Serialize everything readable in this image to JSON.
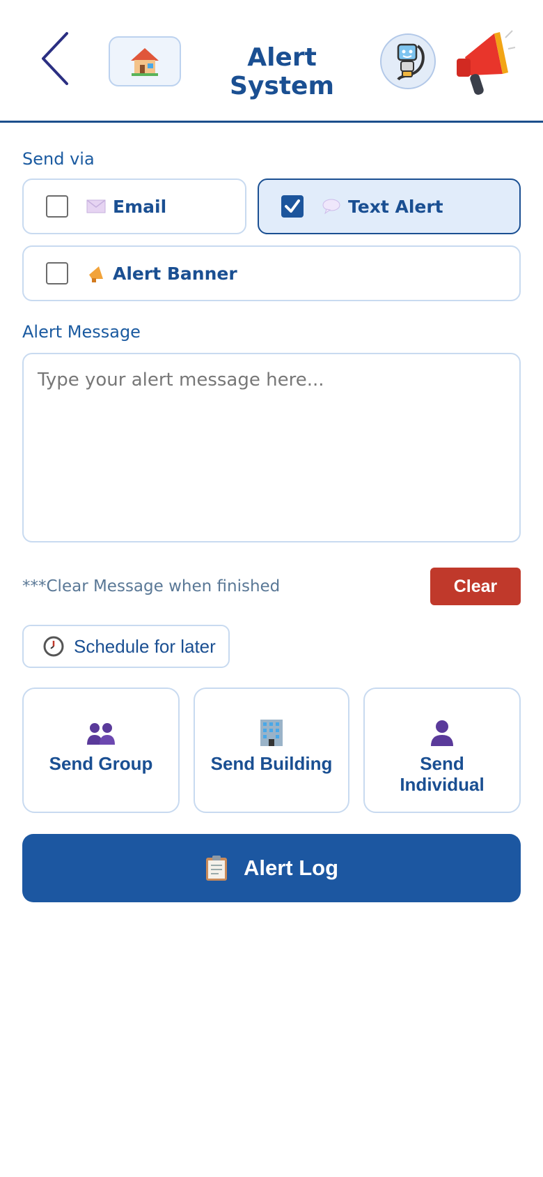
{
  "header": {
    "title": "Alert System",
    "back_icon": "chevron-left-icon",
    "home_icon": "house-icon",
    "bot_icon": "robot-icon",
    "megaphone_icon": "megaphone-icon"
  },
  "send_via": {
    "label": "Send via",
    "options": [
      {
        "label": "Email",
        "icon": "envelope-icon",
        "checked": false
      },
      {
        "label": "Text Alert",
        "icon": "speech-bubble-icon",
        "checked": true
      },
      {
        "label": "Alert Banner",
        "icon": "megaphone-icon",
        "checked": false
      }
    ]
  },
  "message": {
    "label": "Alert Message",
    "placeholder": "Type your alert message here...",
    "value": ""
  },
  "hint": "***Clear Message when finished",
  "clear_label": "Clear",
  "schedule_label": "Schedule for later",
  "send_targets": [
    {
      "label": "Send Group",
      "icon": "group-icon"
    },
    {
      "label": "Send Building",
      "icon": "building-icon"
    },
    {
      "label": "Send Individual",
      "icon": "person-icon"
    }
  ],
  "alert_log_label": "Alert Log",
  "colors": {
    "primary": "#1c57a1",
    "danger": "#c0392b",
    "border": "#c8daf0",
    "selected_bg": "#e1ecfa"
  }
}
